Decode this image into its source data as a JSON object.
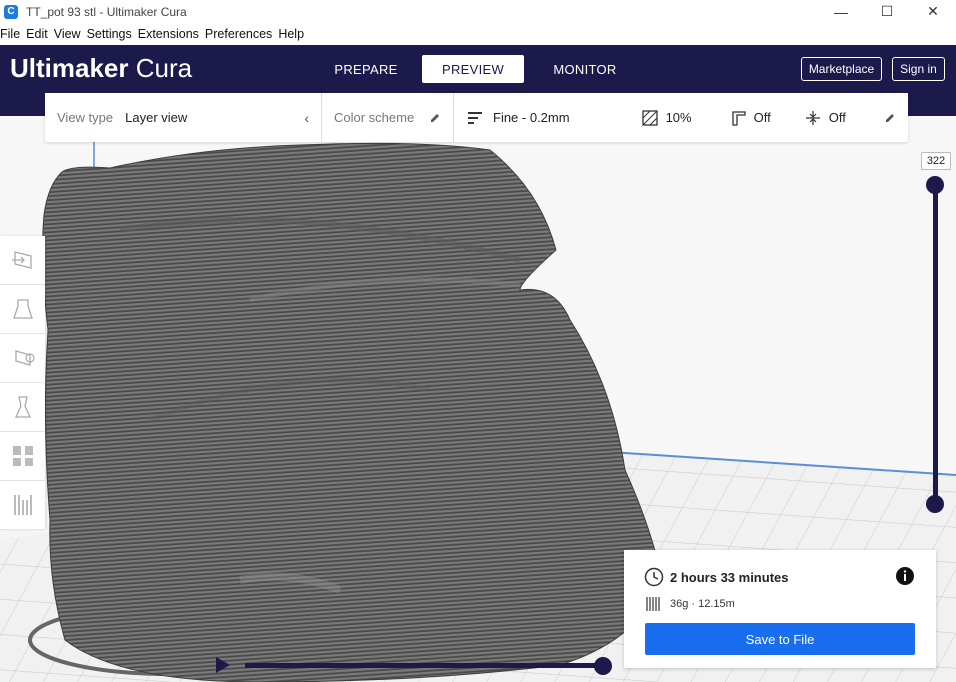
{
  "window": {
    "title": "TT_pot 93 stl - Ultimaker Cura",
    "app_icon_letter": "C",
    "controls": [
      "—",
      "☐",
      "✕"
    ]
  },
  "menu": [
    "File",
    "Edit",
    "View",
    "Settings",
    "Extensions",
    "Preferences",
    "Help"
  ],
  "header": {
    "logo_bold": "Ultimaker",
    "logo_light": " Cura",
    "tabs": [
      {
        "label": "PREPARE",
        "active": false
      },
      {
        "label": "PREVIEW",
        "active": true
      },
      {
        "label": "MONITOR",
        "active": false
      }
    ],
    "marketplace_label": "Marketplace",
    "signin_label": "Sign in"
  },
  "toolbar": {
    "view_type_label": "View type",
    "view_type_value": "Layer view",
    "color_scheme_label": "Color scheme",
    "profile": "Fine - 0.2mm",
    "infill": "10%",
    "support": "Off",
    "adhesion": "Off"
  },
  "layer_slider": {
    "current_layer": "322"
  },
  "print_info": {
    "time": "2 hours 33 minutes",
    "material": "36g · 12.15m",
    "save_label": "Save to File"
  },
  "colors": {
    "header_bg": "#1c1a4a",
    "accent_blue": "#196ef0",
    "model_gray": "#6d6d6d"
  }
}
